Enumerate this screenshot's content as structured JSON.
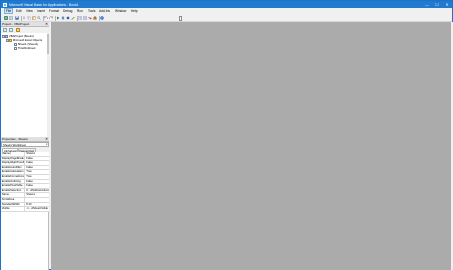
{
  "window": {
    "title": "Microsoft Visual Basic for Applications - Book1",
    "minimize": "—",
    "maximize": "☐",
    "close": "✕"
  },
  "menu": [
    "File",
    "Edit",
    "View",
    "Insert",
    "Format",
    "Debug",
    "Run",
    "Tools",
    "Add-Ins",
    "Window",
    "Help"
  ],
  "toolbar_icons": [
    "excel-icon",
    "insert-module-icon",
    "save-icon",
    "cut-icon",
    "copy-icon",
    "paste-icon",
    "find-icon",
    "undo-icon",
    "redo-icon",
    "run-icon",
    "break-icon",
    "reset-icon",
    "design-mode-icon",
    "project-explorer-icon",
    "properties-window-icon",
    "object-browser-icon",
    "toolbox-icon",
    "help-icon"
  ],
  "project_pane": {
    "title": "Project - VBAProject",
    "close": "✕",
    "tree": [
      {
        "label": "VBAProject (Book1)",
        "toggle": "−",
        "icon": "project-icon",
        "level": 0
      },
      {
        "label": "Microsoft Excel Objects",
        "toggle": "−",
        "icon": "folder-icon",
        "level": 1
      },
      {
        "label": "Sheet1 (Sheet1)",
        "toggle": "",
        "icon": "sheet-icon",
        "level": 2
      },
      {
        "label": "ThisWorkbook",
        "toggle": "",
        "icon": "workbook-icon",
        "level": 2
      }
    ]
  },
  "properties_pane": {
    "title": "Properties - Sheet1",
    "close": "✕",
    "object": "Sheet1 Worksheet",
    "tabs": [
      "Alphabetic",
      "Categorized"
    ],
    "rows": [
      {
        "name": "(Name)",
        "value": "Sheet1"
      },
      {
        "name": "DisplayPageBreaks",
        "value": "False"
      },
      {
        "name": "DisplayRightToLeft",
        "value": "False"
      },
      {
        "name": "EnableAutoFilter",
        "value": "False"
      },
      {
        "name": "EnableCalculation",
        "value": "True"
      },
      {
        "name": "EnableFormatConditionsCalcu",
        "value": "True"
      },
      {
        "name": "EnableOutlining",
        "value": "False"
      },
      {
        "name": "EnablePivotTable",
        "value": "False"
      },
      {
        "name": "EnableSelection",
        "value": "0 - xlNoRestrictions"
      },
      {
        "name": "Name",
        "value": "Sheet1"
      },
      {
        "name": "ScrollArea",
        "value": ""
      },
      {
        "name": "StandardWidth",
        "value": "8.43"
      },
      {
        "name": "Visible",
        "value": "-1 - xlSheetVisible"
      }
    ]
  },
  "colors": {
    "titlebar": "#1f7ad0",
    "mdi_background": "#ababab"
  }
}
